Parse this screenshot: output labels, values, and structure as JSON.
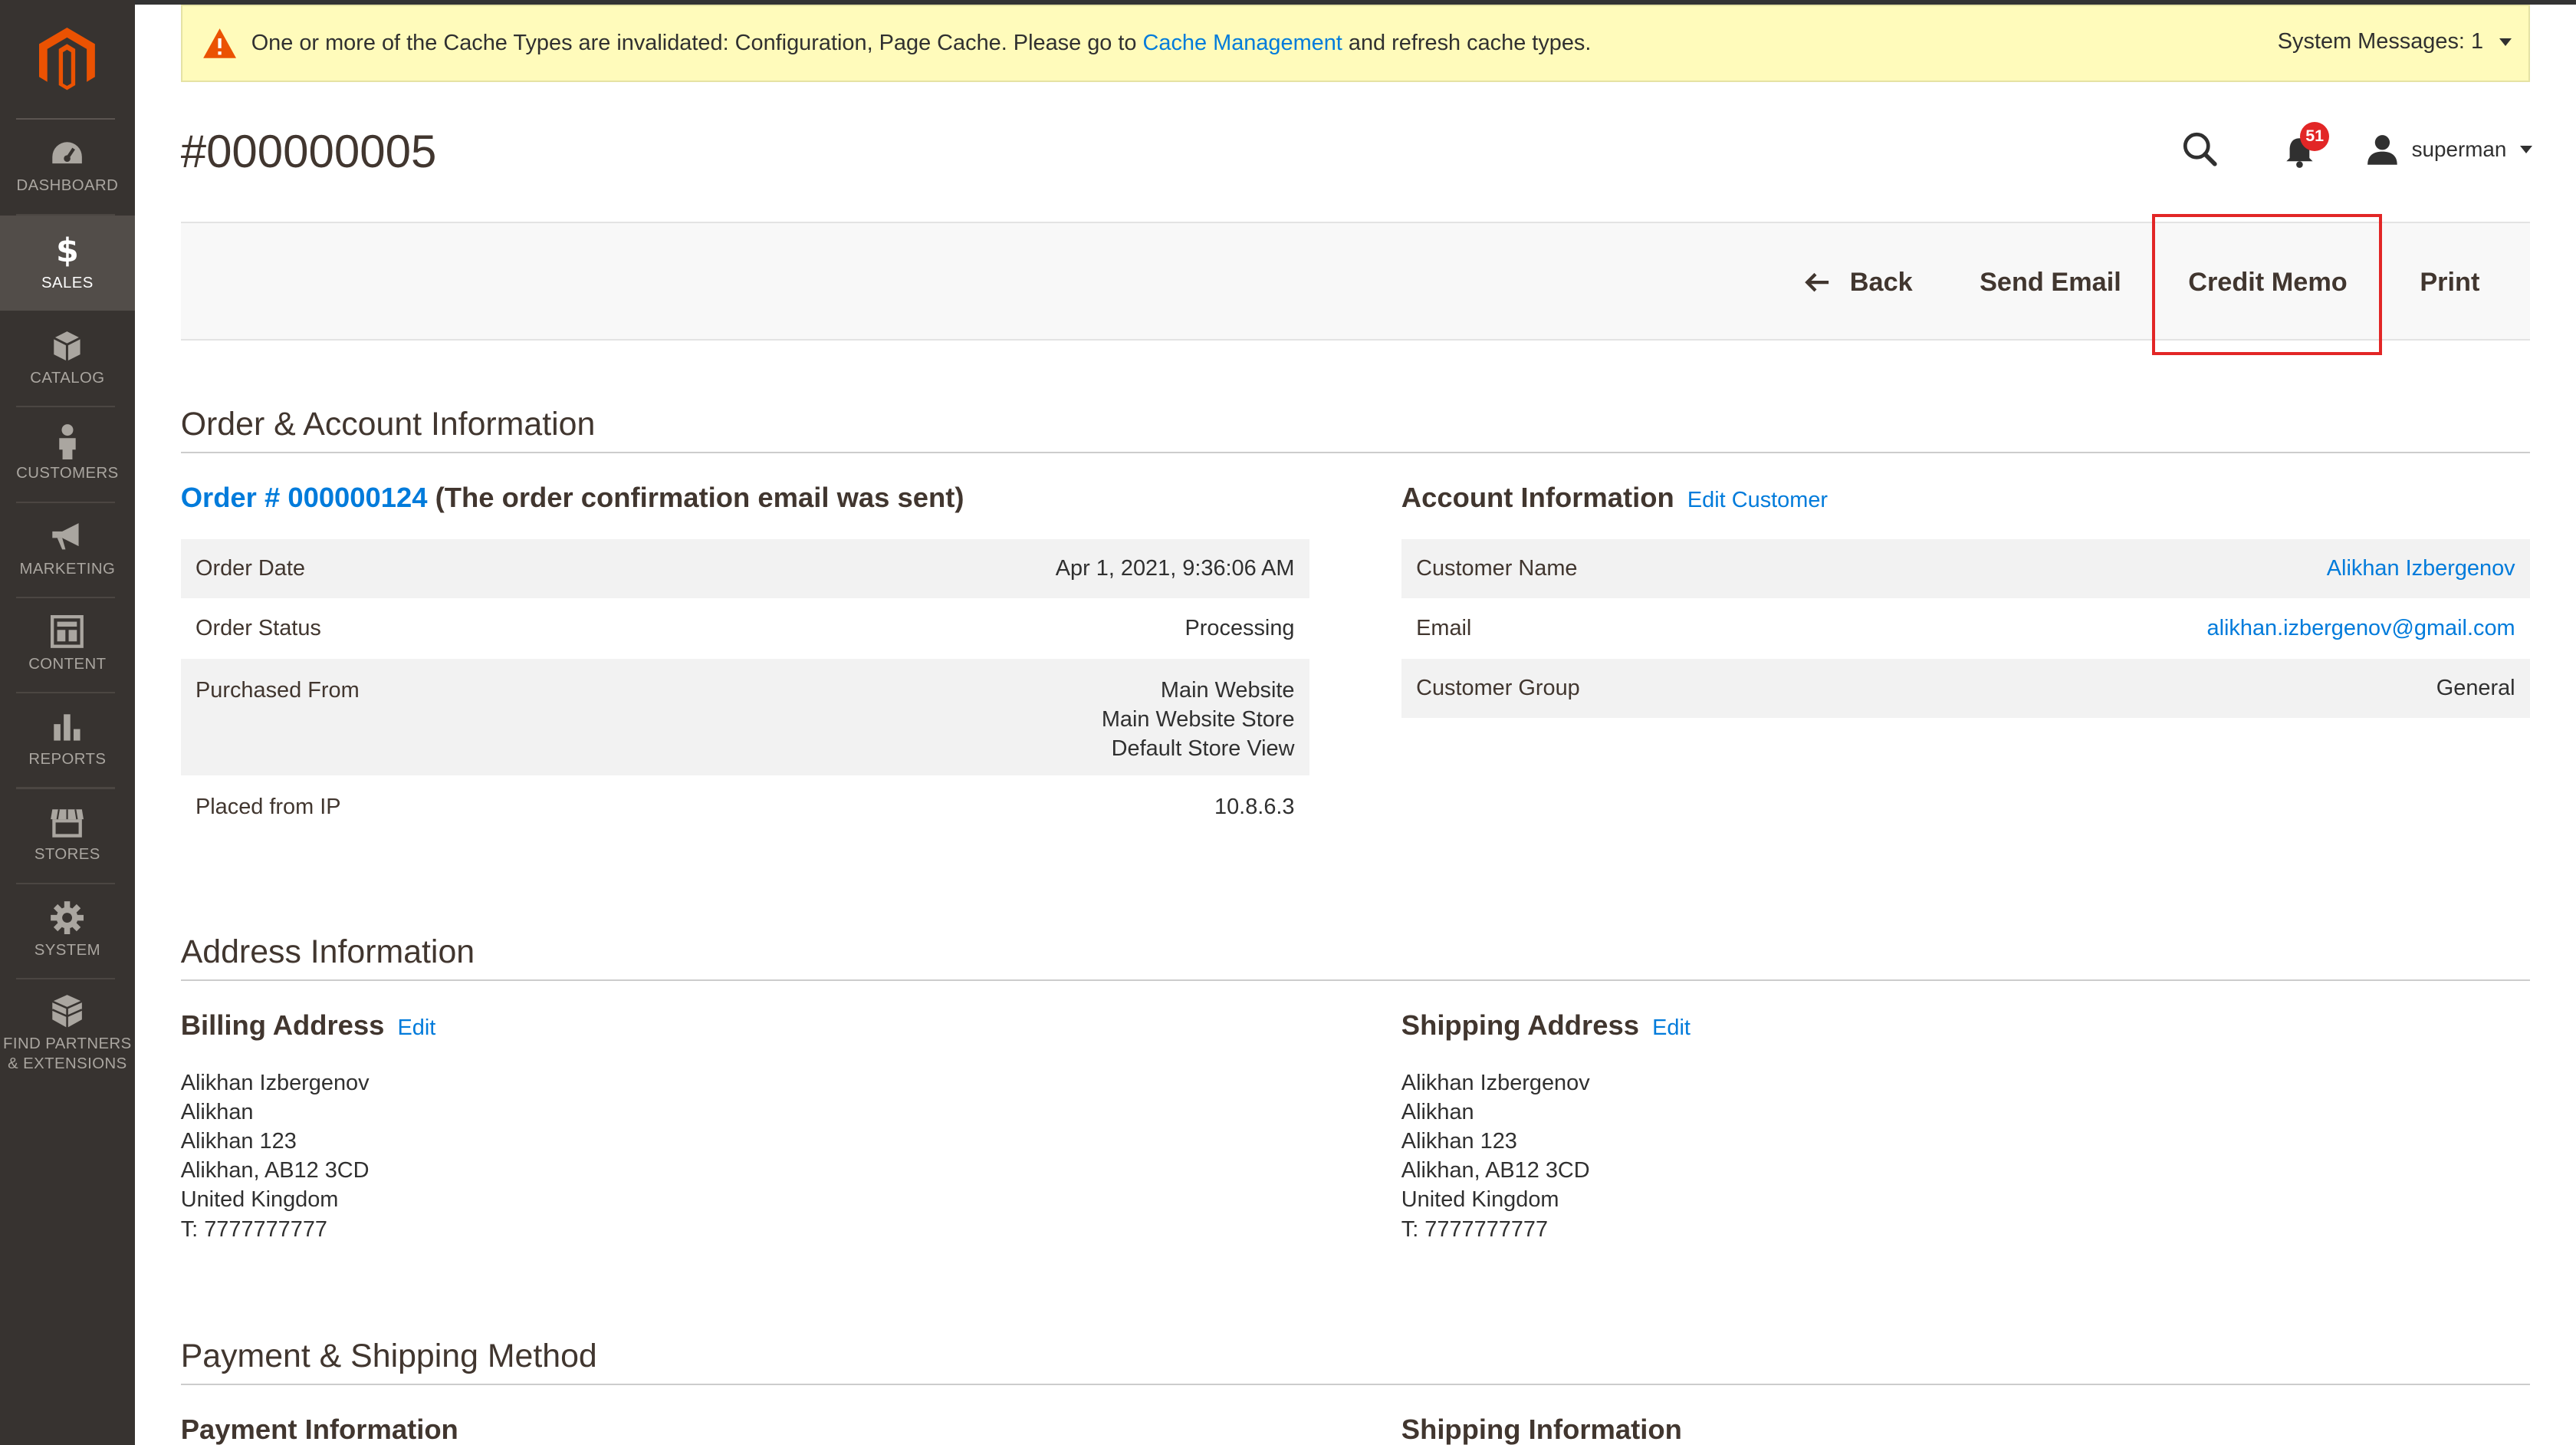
{
  "colors": {
    "sidebar_bg": "#373330",
    "sidebar_active": "#524d49",
    "accent_orange": "#eb5202",
    "link_blue": "#007bdb",
    "message_bg": "#fffbbb",
    "badge_red": "#e22626",
    "highlight_red": "#e22626"
  },
  "sidebar": {
    "logo_icon": "magento-logo-icon",
    "items": [
      {
        "label": "DASHBOARD",
        "icon": "dashboard-icon"
      },
      {
        "label": "SALES",
        "icon": "dollar-icon",
        "active": true
      },
      {
        "label": "CATALOG",
        "icon": "box-icon"
      },
      {
        "label": "CUSTOMERS",
        "icon": "person-icon"
      },
      {
        "label": "MARKETING",
        "icon": "megaphone-icon"
      },
      {
        "label": "CONTENT",
        "icon": "layout-icon"
      },
      {
        "label": "REPORTS",
        "icon": "bar-chart-icon"
      },
      {
        "label": "STORES",
        "icon": "storefront-icon"
      },
      {
        "label": "SYSTEM",
        "icon": "gear-icon"
      },
      {
        "label_line1": "FIND PARTNERS",
        "label_line2": "& EXTENSIONS",
        "icon": "cube-stack-icon"
      }
    ]
  },
  "system_message": {
    "text_before": "One or more of the Cache Types are invalidated: Configuration, Page Cache. Please go to ",
    "link": "Cache Management",
    "text_after": " and refresh cache types.",
    "counter": "System Messages: 1"
  },
  "header": {
    "title": "#000000005",
    "notification_count": "51",
    "username": "superman"
  },
  "toolbar": {
    "back": "Back",
    "send_email": "Send Email",
    "credit_memo": "Credit Memo",
    "print": "Print"
  },
  "order_account": {
    "section_title": "Order & Account Information",
    "order_link": "Order # 000000124",
    "order_note": " (The order confirmation email was sent)",
    "order_rows": [
      {
        "label": "Order Date",
        "value": "Apr 1, 2021, 9:36:06 AM"
      },
      {
        "label": "Order Status",
        "value": "Processing"
      },
      {
        "label": "Purchased From",
        "value_lines": [
          "Main Website",
          "Main Website Store",
          "Default Store View"
        ]
      },
      {
        "label": "Placed from IP",
        "value": "10.8.6.3"
      }
    ],
    "account_title": "Account Information",
    "edit_customer": "Edit Customer",
    "account_rows": [
      {
        "label": "Customer Name",
        "value": "Alikhan Izbergenov"
      },
      {
        "label": "Email",
        "value": "alikhan.izbergenov@gmail.com"
      },
      {
        "label": "Customer Group",
        "value": "General"
      }
    ]
  },
  "address": {
    "section_title": "Address Information",
    "billing_title": "Billing Address",
    "billing_edit": "Edit",
    "billing_lines": [
      "Alikhan Izbergenov",
      "Alikhan",
      "Alikhan 123",
      "Alikhan, AB12 3CD",
      "United Kingdom",
      "T: 7777777777"
    ],
    "shipping_title": "Shipping Address",
    "shipping_edit": "Edit",
    "shipping_lines": [
      "Alikhan Izbergenov",
      "Alikhan",
      "Alikhan 123",
      "Alikhan, AB12 3CD",
      "United Kingdom",
      "T: 7777777777"
    ]
  },
  "payment_shipping": {
    "section_title": "Payment & Shipping Method",
    "payment_title": "Payment Information",
    "shipping_title": "Shipping Information"
  }
}
